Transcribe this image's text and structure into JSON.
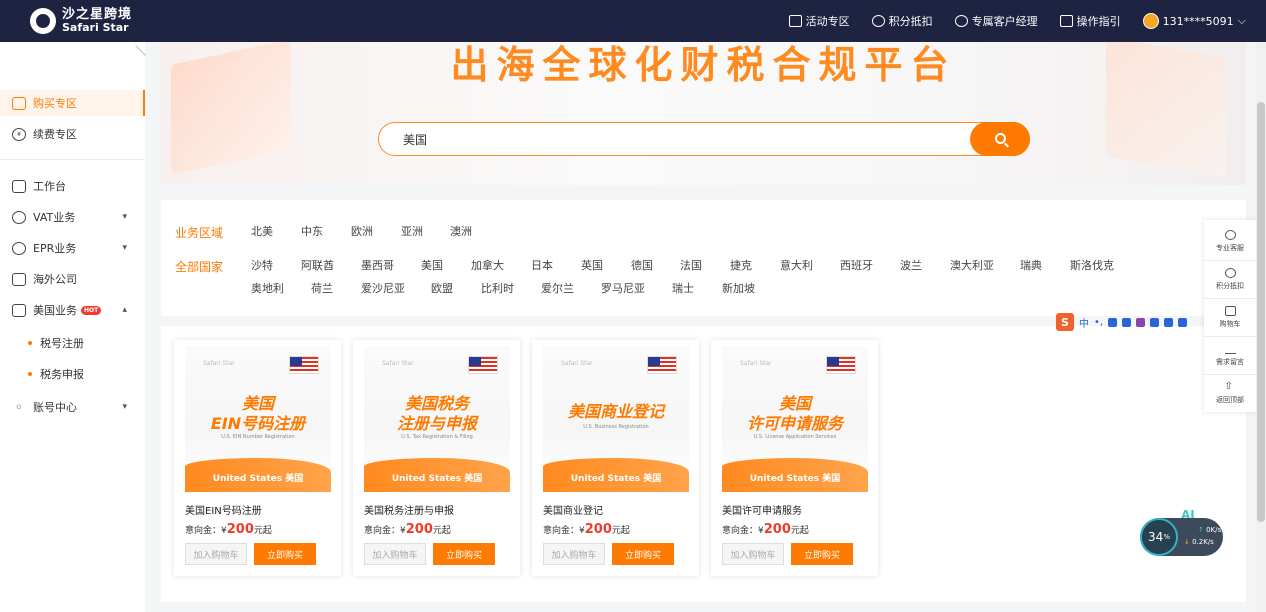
{
  "header": {
    "logo_cn": "沙之星跨境",
    "logo_en": "Safari Star",
    "nav": [
      {
        "label": "活动专区",
        "icon": "gift-icon"
      },
      {
        "label": "积分抵扣",
        "icon": "coins-icon"
      },
      {
        "label": "专属客户经理",
        "icon": "person-icon"
      },
      {
        "label": "操作指引",
        "icon": "guide-icon"
      }
    ],
    "user": "131****5091"
  },
  "sidebar": {
    "items": [
      {
        "label": "购买专区",
        "icon": "shop-icon"
      },
      {
        "label": "续费专区",
        "icon": "yuan-icon"
      },
      {
        "label": "工作台",
        "icon": "chart-icon"
      },
      {
        "label": "VAT业务",
        "icon": "vat-icon"
      },
      {
        "label": "EPR业务",
        "icon": "epr-icon"
      },
      {
        "label": "海外公司",
        "icon": "building-icon"
      },
      {
        "label": "美国业务",
        "icon": "us-icon"
      },
      {
        "label": "账号中心",
        "icon": "user-icon"
      }
    ],
    "hot_badge": "HOT",
    "sub_items": [
      "税号注册",
      "税务申报"
    ]
  },
  "banner": {
    "title": "出海全球化财税合规平台",
    "search_value": "美国"
  },
  "filter": {
    "region_label": "业务区域",
    "regions": [
      "北美",
      "中东",
      "欧洲",
      "亚洲",
      "澳洲"
    ],
    "country_label": "全部国家",
    "countries_row1": [
      "沙特",
      "阿联酋",
      "墨西哥",
      "美国",
      "加拿大",
      "日本",
      "英国",
      "德国",
      "法国",
      "捷克",
      "意大利",
      "西班牙",
      "波兰",
      "澳大利亚",
      "瑞典",
      "斯洛伐克"
    ],
    "countries_row2": [
      "奥地利",
      "荷兰",
      "爱沙尼亚",
      "欧盟",
      "比利时",
      "爱尔兰",
      "罗马尼亚",
      "瑞士",
      "新加坡"
    ]
  },
  "products": [
    {
      "title1": "美国",
      "title2": "EIN号码注册",
      "sub": "U.S. EIN Number Registration",
      "foot": "United States 美国",
      "name": "美国EIN号码注册",
      "price_label": "意向金：",
      "currency": "¥",
      "price": "200",
      "price_suffix": "元起",
      "cart": "加入购物车",
      "buy": "立即购买"
    },
    {
      "title1": "美国税务",
      "title2": "注册与申报",
      "sub": "U.S. Tax Registration & Filing",
      "foot": "United States 美国",
      "name": "美国税务注册与申报",
      "price_label": "意向金：",
      "currency": "¥",
      "price": "200",
      "price_suffix": "元起",
      "cart": "加入购物车",
      "buy": "立即购买"
    },
    {
      "title1": "美国商业登记",
      "title2": "",
      "sub": "U.S. Business Registration",
      "foot": "United States 美国",
      "name": "美国商业登记",
      "price_label": "意向金：",
      "currency": "¥",
      "price": "200",
      "price_suffix": "元起",
      "cart": "加入购物车",
      "buy": "立即购买"
    },
    {
      "title1": "美国",
      "title2": "许可申请服务",
      "sub": "U.S. License Application Services",
      "foot": "United States 美国",
      "name": "美国许可申请服务",
      "price_label": "意向金：",
      "currency": "¥",
      "price": "200",
      "price_suffix": "元起",
      "cart": "加入购物车",
      "buy": "立即购买"
    }
  ],
  "tools": [
    {
      "label": "专业客服",
      "icon": "headset-icon"
    },
    {
      "label": "积分抵扣",
      "icon": "coins-icon"
    },
    {
      "label": "购物车",
      "icon": "cart-icon"
    },
    {
      "label": "需求留言",
      "icon": "pen-icon"
    },
    {
      "label": "返回顶部",
      "icon": "arrow-up-icon"
    }
  ],
  "ime": {
    "s": "S",
    "mode": "中",
    "punct": "•,"
  },
  "meter": {
    "percent": "34",
    "unit": "%",
    "up": "0K/s",
    "down": "0.2K/s",
    "ai": "AI"
  }
}
